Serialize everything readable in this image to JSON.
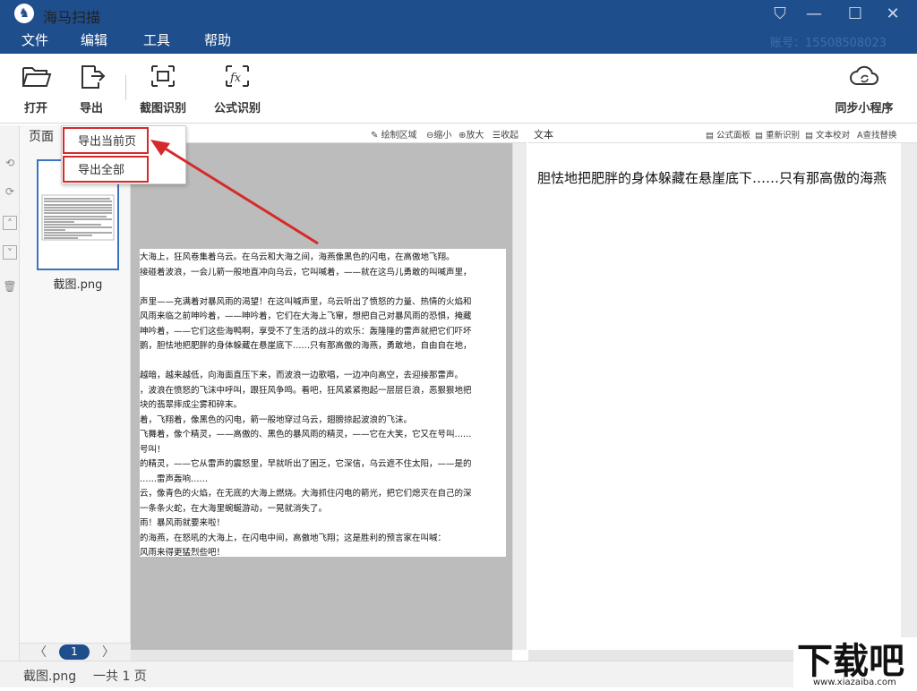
{
  "window": {
    "title": "海马扫描",
    "account": "账号：15508508023"
  },
  "menu": [
    "文件",
    "编辑",
    "工具",
    "帮助"
  ],
  "toolbar": {
    "open": "打开",
    "export": "导出",
    "screenshot_ocr": "截图识别",
    "formula_ocr": "公式识别",
    "sync": "同步小程序"
  },
  "pages_panel": {
    "title": "页面",
    "thumb_name": "截图.png",
    "page_number": "1"
  },
  "image_view": {
    "tools": [
      "绘制区域",
      "缩小",
      "放大",
      "收起"
    ]
  },
  "document_lines": [
    "大海上，狂风卷集着乌云。在乌云和大海之间，海燕像黑色的闪电，在高傲地飞翔。",
    "接碰着波浪，一会儿箭一般地直冲向乌云，它叫喊着，——就在这鸟儿勇敢的叫喊声里，",
    "",
    "声里——充满着对暴风雨的渴望！在这叫喊声里，乌云听出了愤怒的力量、热情的火焰和",
    "风雨来临之前呻吟着，——呻吟着，它们在大海上飞窜，想把自己对暴风雨的恐惧，掩藏",
    "呻吟着，——它们这些海鸭啊，享受不了生活的战斗的欢乐：轰隆隆的雷声就把它们吓坏",
    "鹅，胆怯地把肥胖的身体躲藏在悬崖底下……只有那高傲的海燕，勇敢地，自由自在地，",
    "",
    "越暗，越来越低，向海面直压下来，而波浪一边歌唱，一边冲向高空，去迎接那雷声。",
    "，波浪在愤怒的飞沫中呼叫，跟狂风争鸣。看吧，狂风紧紧抱起一层层巨浪，恶狠狠地把",
    "块的翡翠摔成尘雾和碎末。",
    "着，飞翔着，像黑色的闪电，箭一般地穿过乌云，翅膀掠起波浪的飞沫。",
    "飞舞着，像个精灵，——高傲的、黑色的暴风雨的精灵，——它在大笑，它又在号叫……",
    "号叫！",
    "的精灵，——它从雷声的震怒里，早就听出了困乏，它深信，乌云遮不住太阳，——是的",
    "……雷声轰响……",
    "云，像青色的火焰，在无底的大海上燃烧。大海抓住闪电的箭光，把它们熄灭在自己的深",
    "一条条火蛇，在大海里蜿蜒游动，一晃就消失了。",
    "雨！暴风雨就要来啦！",
    "的海燕，在怒吼的大海上，在闪电中间，高傲地飞翔；这是胜利的预言家在叫喊：",
    "风雨来得更猛烈些吧！"
  ],
  "text_panel": {
    "title": "文本",
    "tools": [
      "公式面板",
      "重新识别",
      "文本校对",
      "查找替换"
    ],
    "content": "胆怯地把肥胖的身体躲藏在悬崖底下……只有那高傲的海燕"
  },
  "export_menu": {
    "current_page": "导出当前页",
    "all_pages": "导出全部"
  },
  "status": {
    "file": "截图.png",
    "total": "一共 1 页"
  },
  "watermark": {
    "text": "下载吧",
    "url": "www.xiazaiba.com"
  },
  "colors": {
    "titlebar": "#1f4e8c",
    "highlight": "#d62a2a"
  }
}
